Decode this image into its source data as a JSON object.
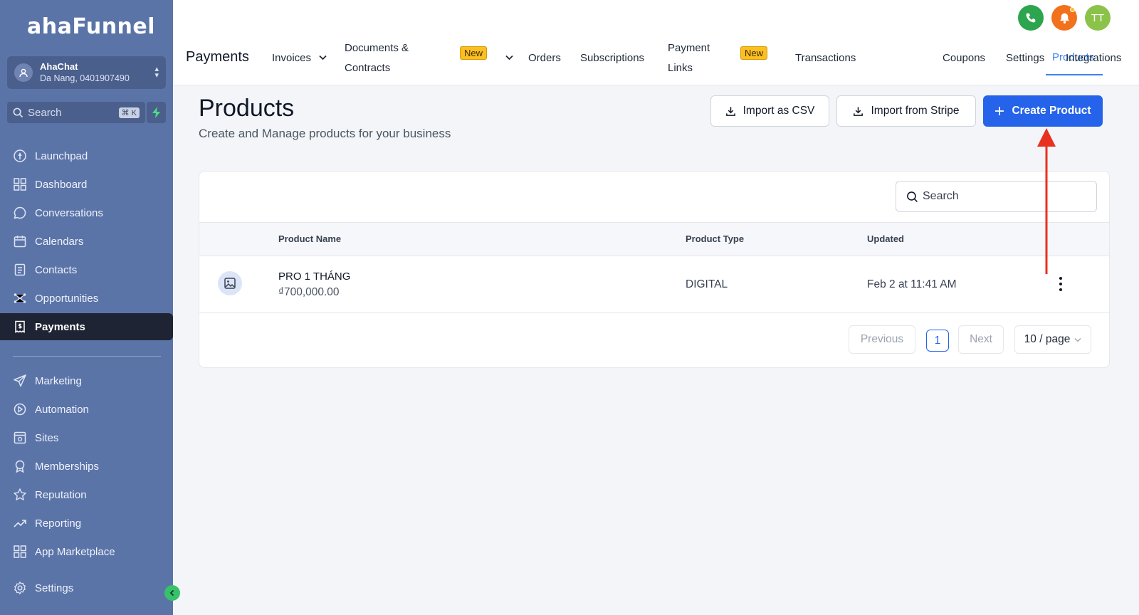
{
  "sidebar": {
    "logo": "ahaFunnel",
    "account": {
      "name": "AhaChat",
      "location": "Da Nang, 0401907490"
    },
    "search": {
      "placeholder": "Search",
      "shortcut": "⌘ K"
    },
    "items": [
      {
        "label": "Launchpad",
        "icon": "rocket-icon"
      },
      {
        "label": "Dashboard",
        "icon": "grid-icon"
      },
      {
        "label": "Conversations",
        "icon": "chat-icon"
      },
      {
        "label": "Calendars",
        "icon": "calendar-icon"
      },
      {
        "label": "Contacts",
        "icon": "contacts-icon"
      },
      {
        "label": "Opportunities",
        "icon": "network-icon"
      },
      {
        "label": "Payments",
        "icon": "receipt-icon",
        "active": true
      },
      {
        "label": "Marketing",
        "icon": "send-icon"
      },
      {
        "label": "Automation",
        "icon": "automation-icon"
      },
      {
        "label": "Sites",
        "icon": "sites-icon"
      },
      {
        "label": "Memberships",
        "icon": "badge-icon"
      },
      {
        "label": "Reputation",
        "icon": "star-icon"
      },
      {
        "label": "Reporting",
        "icon": "trend-icon"
      },
      {
        "label": "App Marketplace",
        "icon": "apps-icon"
      },
      {
        "label": "Settings",
        "icon": "gear-icon"
      }
    ]
  },
  "topbar": {
    "section": "Payments",
    "tabs": {
      "invoices": "Invoices",
      "documents_line1": "Documents &",
      "documents_line2": "Contracts",
      "new_badge": "New",
      "orders": "Orders",
      "subscriptions": "Subscriptions",
      "payment_links_line1": "Payment",
      "payment_links_line2": "Links",
      "transactions": "Transactions",
      "products": "Products",
      "coupons": "Coupons",
      "settings": "Settings",
      "integrations": "Integrations"
    },
    "avatar_initials": "TT",
    "colors": {
      "phone": "#2da44e",
      "bell": "#f2711c",
      "avatar": "#8bc34a",
      "active_tab": "#3b82f6"
    }
  },
  "page": {
    "title": "Products",
    "subtitle": "Create and Manage products for your business",
    "buttons": {
      "import_csv": "Import as CSV",
      "import_stripe": "Import from Stripe",
      "create": "Create Product"
    }
  },
  "table": {
    "search_placeholder": "Search",
    "columns": {
      "name": "Product Name",
      "type": "Product Type",
      "updated": "Updated"
    },
    "rows": [
      {
        "name": "PRO 1 THÁNG",
        "price": "₫700,000.00",
        "type": "DIGITAL",
        "updated": "Feb 2 at 11:41 AM"
      }
    ],
    "pagination": {
      "previous": "Previous",
      "current": "1",
      "next": "Next",
      "page_size": "10 / page"
    }
  }
}
